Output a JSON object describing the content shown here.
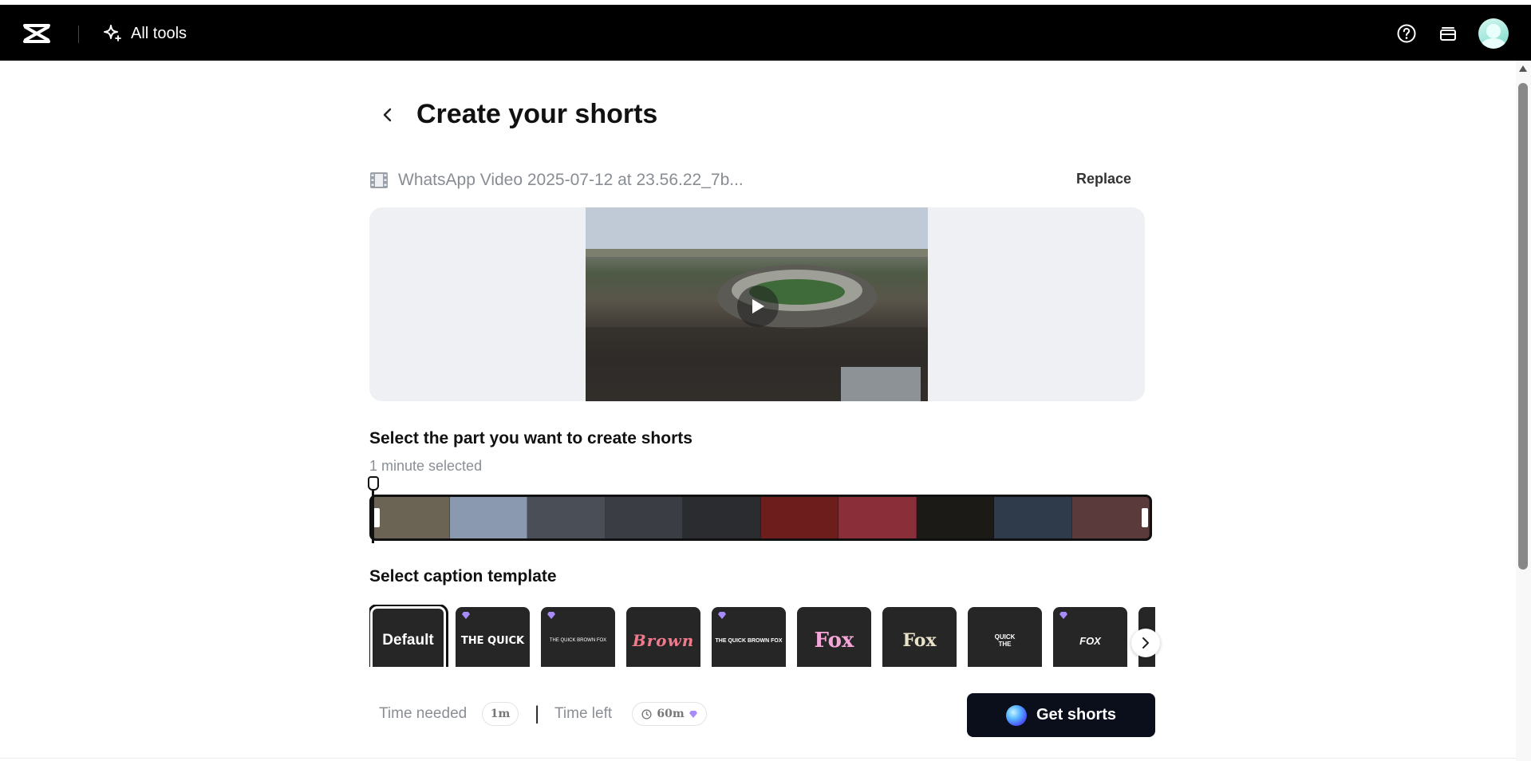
{
  "topbar": {
    "all_tools_label": "All tools",
    "icons": [
      "capcut-logo-icon",
      "sparkle-icon",
      "help-icon",
      "inbox-stack-icon",
      "user-avatar"
    ]
  },
  "page": {
    "title": "Create your shorts"
  },
  "file": {
    "name": "WhatsApp Video 2025-07-12 at 23.56.22_7b...",
    "replace_label": "Replace"
  },
  "selection": {
    "heading": "Select the part you want to create shorts",
    "info": "1 minute selected",
    "frame_colors": [
      "#6b6455",
      "#8a98b0",
      "#4a4f57",
      "#3a3d44",
      "#2b2c30",
      "#6e1d1d",
      "#8a2f3a",
      "#1c1a17",
      "#2f3a4a",
      "#5a3a3a"
    ]
  },
  "captions": {
    "heading": "Select caption template",
    "templates": [
      {
        "label": "Default",
        "premium": false,
        "selected": true
      },
      {
        "label": "THE QUICK",
        "premium": true,
        "selected": false
      },
      {
        "label": "THE QUICK BROWN FOX",
        "premium": true,
        "selected": false
      },
      {
        "label": "Brown",
        "premium": false,
        "selected": false
      },
      {
        "label": "THE QUICK BROWN FOX",
        "premium": true,
        "selected": false
      },
      {
        "label": "Fox",
        "premium": false,
        "selected": false
      },
      {
        "label": "Fox",
        "premium": false,
        "selected": false
      },
      {
        "label": "QUICK THE",
        "premium": false,
        "selected": false
      },
      {
        "label": "FOX",
        "premium": true,
        "selected": false
      }
    ]
  },
  "footer": {
    "time_needed_label": "Time needed",
    "time_needed_value": "1m",
    "separator": "|",
    "time_left_label": "Time left",
    "time_left_value": "60m",
    "cta_label": "Get shorts"
  },
  "colors": {
    "topbar_bg": "#000000",
    "cta_bg": "#0b0f1c",
    "premium_gem": "#a78bfa",
    "template_bg": "#262626"
  }
}
